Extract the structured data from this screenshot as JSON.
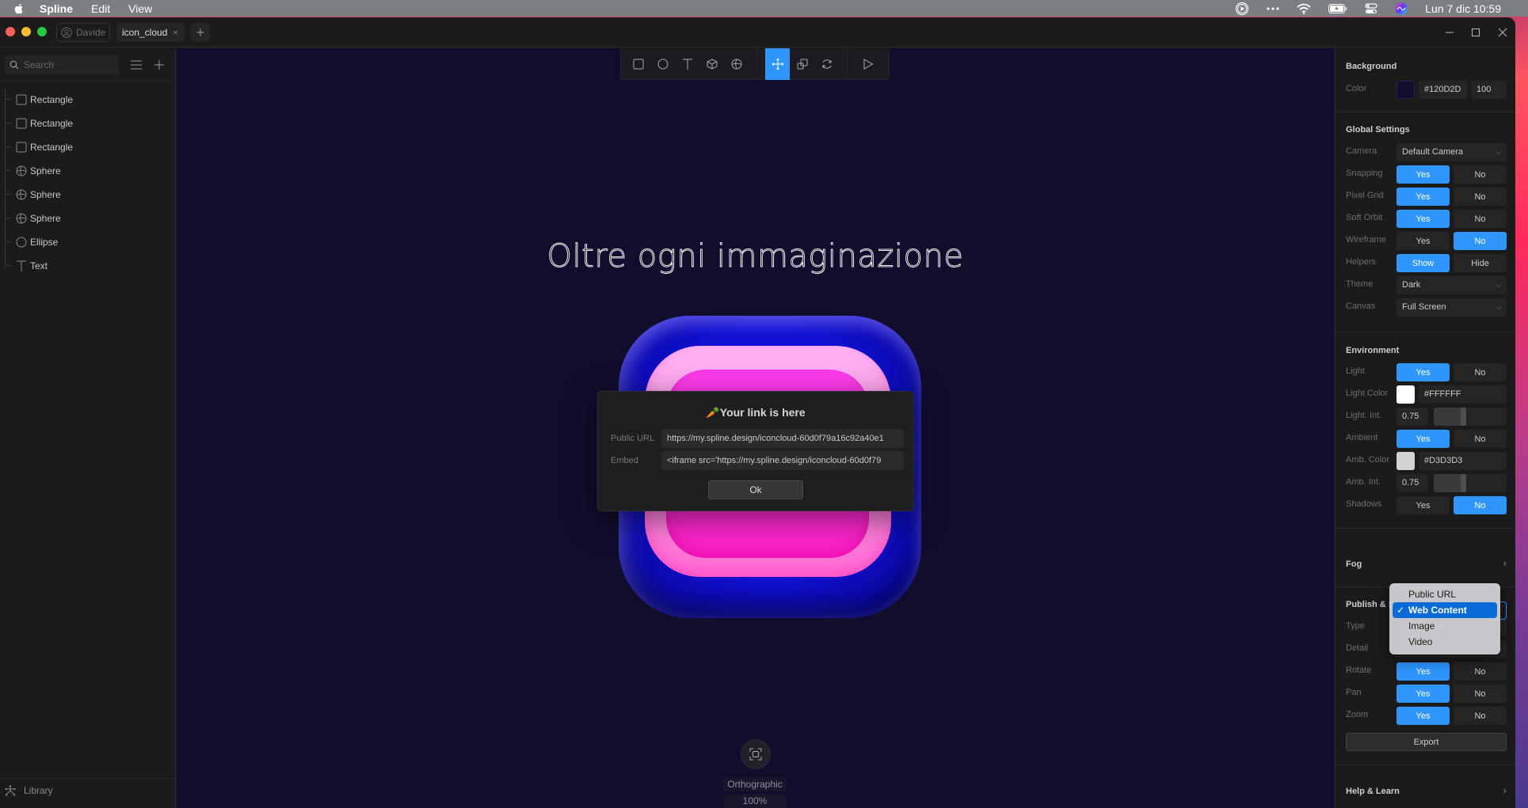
{
  "menubar": {
    "app_name": "Spline",
    "menus": [
      "Edit",
      "View"
    ],
    "clock": "Lun 7 dic  10:59",
    "status_icons": [
      "play-circle-icon",
      "more-icon",
      "wifi-icon",
      "battery-charging-icon",
      "control-center-icon",
      "siri-icon"
    ]
  },
  "titlebar": {
    "user": "Davide",
    "tab_title": "icon_cloud",
    "tab_close": "×",
    "add_tab": "+"
  },
  "sidebar": {
    "search_placeholder": "Search",
    "items": [
      {
        "label": "Rectangle",
        "icon": "rectangle-icon"
      },
      {
        "label": "Rectangle",
        "icon": "rectangle-icon"
      },
      {
        "label": "Rectangle",
        "icon": "rectangle-icon"
      },
      {
        "label": "Sphere",
        "icon": "sphere-icon"
      },
      {
        "label": "Sphere",
        "icon": "sphere-icon"
      },
      {
        "label": "Sphere",
        "icon": "sphere-icon"
      },
      {
        "label": "Ellipse",
        "icon": "ellipse-icon"
      },
      {
        "label": "Text",
        "icon": "text-icon"
      }
    ],
    "library_label": "Library"
  },
  "toolbar": {
    "tools": [
      "rectangle-tool",
      "ellipse-tool",
      "text-tool",
      "cube-tool",
      "sphere-tool",
      "move-tool",
      "scale-tool",
      "rotate-tool",
      "play-button"
    ],
    "active_tool": "move-tool"
  },
  "canvas": {
    "headline": "Oltre ogni immaginazione",
    "camera_mode": "Orthographic",
    "zoom": "100%"
  },
  "dialog": {
    "title": "Your link is here",
    "title_emoji": "🥕",
    "public_url_label": "Public URL",
    "public_url_value": "https://my.spline.design/iconcloud-60d0f79a16c92a40e1",
    "embed_label": "Embed",
    "embed_value": "<iframe src='https://my.spline.design/iconcloud-60d0f79",
    "ok_label": "Ok"
  },
  "panel": {
    "background": {
      "title": "Background",
      "color_label": "Color",
      "color_hex": "#120D2D",
      "opacity": "100",
      "swatch": "#120d2d"
    },
    "global": {
      "title": "Global Settings",
      "camera_label": "Camera",
      "camera_value": "Default Camera",
      "snapping_label": "Snapping",
      "snapping": "Yes",
      "pixel_grid_label": "Pixel Grid",
      "pixel_grid": "Yes",
      "soft_orbit_label": "Soft Orbit",
      "soft_orbit": "Yes",
      "wireframe_label": "Wireframe",
      "wireframe": "No",
      "helpers_label": "Helpers",
      "helpers": "Show",
      "theme_label": "Theme",
      "theme_value": "Dark",
      "canvas_label": "Canvas",
      "canvas_value": "Full Screen",
      "yes": "Yes",
      "no": "No",
      "show": "Show",
      "hide": "Hide"
    },
    "environment": {
      "title": "Environment",
      "light_label": "Light",
      "light": "Yes",
      "light_color_label": "Light Color",
      "light_color_hex": "#FFFFFF",
      "light_swatch": "#ffffff",
      "light_int_label": "Light. Int.",
      "light_int": "0.75",
      "light_int_fraction": 0.75,
      "ambient_label": "Ambient",
      "ambient": "Yes",
      "amb_color_label": "Amb. Color",
      "amb_color_hex": "#D3D3D3",
      "amb_swatch": "#d3d3d3",
      "amb_int_label": "Amb. Int.",
      "amb_int": "0.75",
      "amb_int_fraction": 0.75,
      "shadows_label": "Shadows",
      "shadows": "No"
    },
    "fog": {
      "title": "Fog"
    },
    "publish": {
      "title": "Publish & Share",
      "type_label": "Type",
      "type_value": "Web Content",
      "type_options": [
        "Public URL",
        "Web Content",
        "Image",
        "Video"
      ],
      "detail_label": "Detail",
      "rotate_label": "Rotate",
      "rotate": "Yes",
      "pan_label": "Pan",
      "pan": "Yes",
      "zoom_label": "Zoom",
      "zoom": "Yes",
      "export_label": "Export"
    },
    "help": {
      "title": "Help & Learn"
    }
  },
  "colors": {
    "accent": "#2f96ff",
    "canvas_bg": "#120d2d",
    "panel_bg": "#1b1b1c",
    "selected_option": "#0a6bd8"
  }
}
